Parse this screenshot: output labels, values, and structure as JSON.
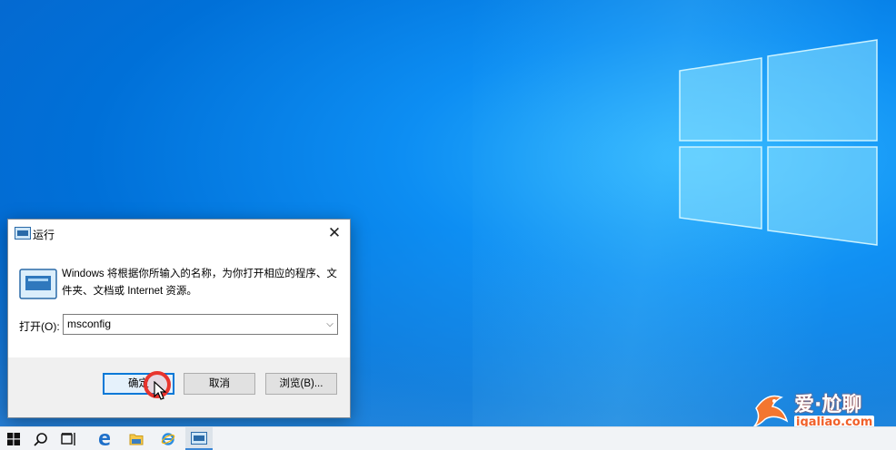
{
  "dialog": {
    "title": "运行",
    "close_glyph": "✕",
    "description": "Windows 将根据你所输入的名称，为你打开相应的程序、文件夹、文档或 Internet 资源。",
    "open_label": "打开(O):",
    "command_value": "msconfig",
    "ok_label": "确定",
    "cancel_label": "取消",
    "browse_label": "浏览(B)..."
  },
  "taskbar": {
    "items": [
      "start-icon",
      "search-icon",
      "task-view-icon",
      "edge-icon",
      "file-explorer-icon",
      "internet-explorer-icon",
      "run-icon"
    ]
  },
  "watermark": {
    "cn": "爱·尬聊",
    "en": "igaliao.com"
  },
  "colors": {
    "desktop_accent": "#0d8ef3",
    "ok_border": "#0078d7",
    "click_marker": "#e8342e",
    "watermark_orange": "#f0602a"
  }
}
